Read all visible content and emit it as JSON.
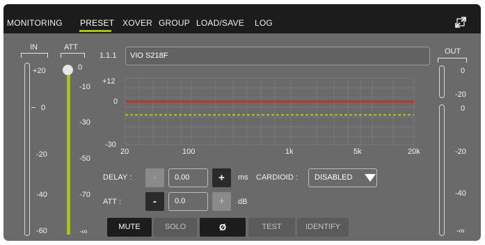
{
  "tabs": [
    "MONITORING",
    "PRESET",
    "XOVER",
    "GROUP",
    "LOAD/SAVE",
    "LOG"
  ],
  "active_tab": "PRESET",
  "colors": {
    "accent": "#a6c41e",
    "response_line": "#e02020",
    "dashed_line": "#b8b84a"
  },
  "in_meter": {
    "label": "IN",
    "scale": [
      "+20",
      "0",
      "-20",
      "-40",
      "-60"
    ]
  },
  "att_slider": {
    "label": "ATT",
    "scale": [
      "0",
      "-10",
      "-30",
      "-50",
      "-70",
      "-∞"
    ],
    "value_db": 0
  },
  "out_meter": {
    "label": "OUT",
    "upper_scale": [
      "0",
      "-20"
    ],
    "lower_scale": [
      "0",
      "-20",
      "-40",
      "-∞"
    ]
  },
  "channel": {
    "id": "1.1.1",
    "name": "VIO S218F"
  },
  "graph": {
    "y_ticks": [
      "+12",
      "0",
      "-30"
    ],
    "x_ticks": [
      "20",
      "100",
      "1k",
      "5k",
      "20k"
    ]
  },
  "delay": {
    "label": "DELAY :",
    "minus": "-",
    "value": "0.00",
    "plus": "+",
    "unit": "ms"
  },
  "cardioid": {
    "label": "CARDIOID :",
    "value": "DISABLED"
  },
  "att": {
    "label": "ATT :",
    "minus": "-",
    "value": "0.0",
    "plus": "+",
    "unit": "dB"
  },
  "buttons": {
    "mute": "MUTE",
    "solo": "SOLO",
    "phase": "Ø",
    "test": "TEST",
    "identify": "IDENTIFY"
  }
}
